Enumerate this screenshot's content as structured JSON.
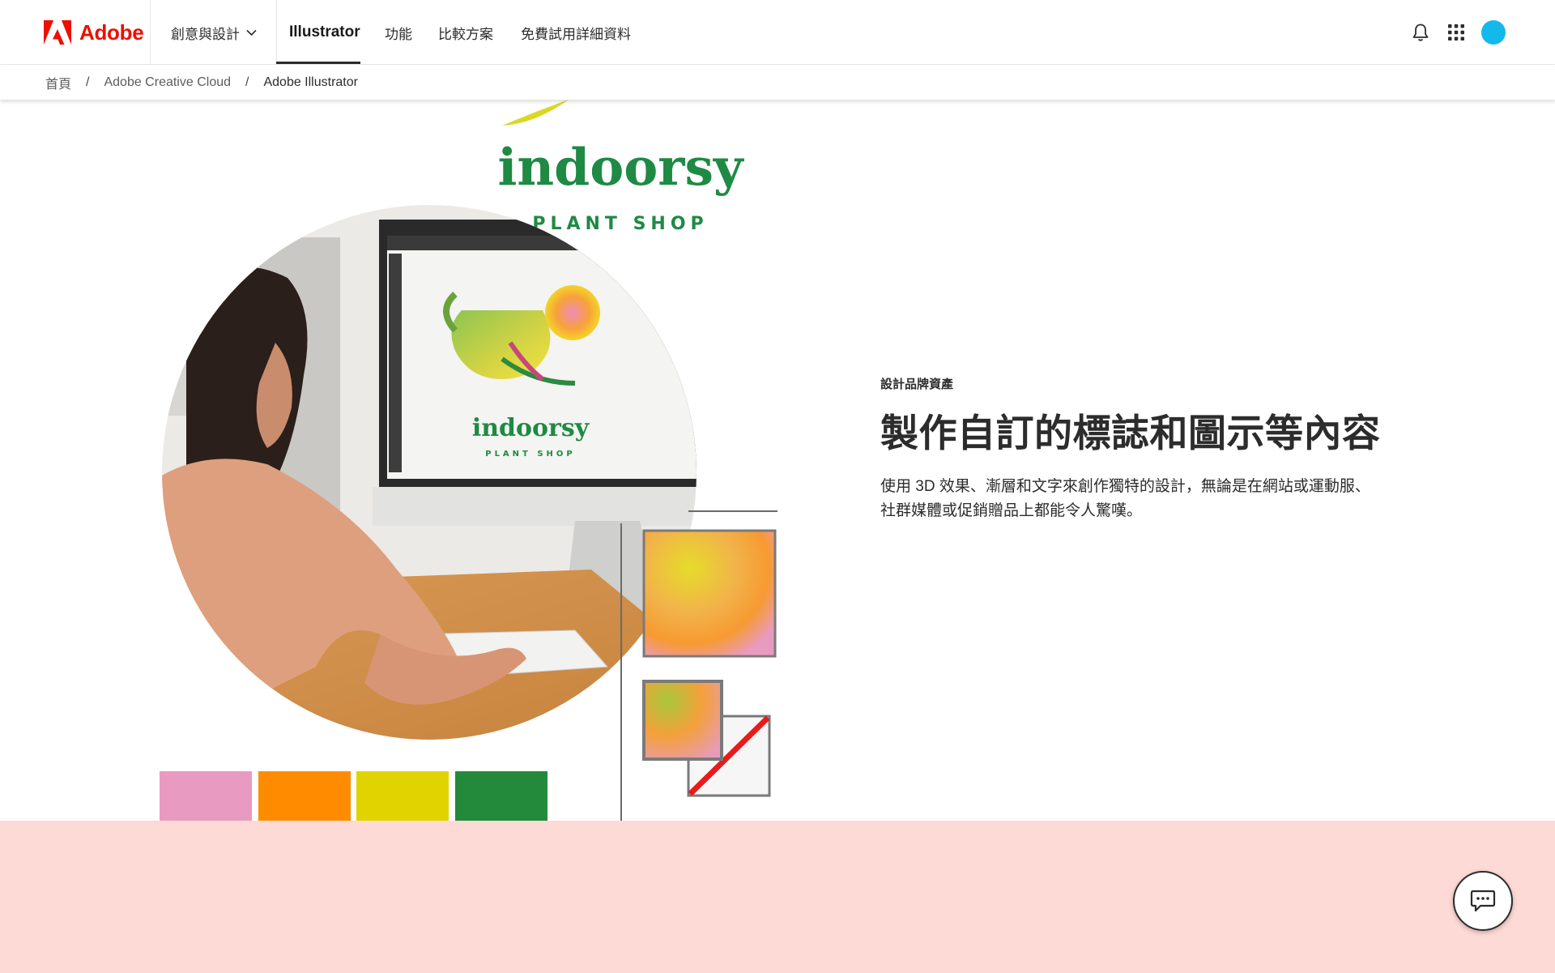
{
  "brand": {
    "name": "Adobe",
    "color": "#eb1000"
  },
  "nav": {
    "dropdown_label": "創意與設計",
    "active_item": "Illustrator",
    "items": [
      "功能",
      "比較方案",
      "免費試用詳細資料"
    ]
  },
  "header_icons": [
    "bell-icon",
    "apps-grid-icon",
    "avatar"
  ],
  "breadcrumb": {
    "items": [
      "首頁",
      "Adobe Creative Cloud"
    ],
    "current": "Adobe Illustrator",
    "separator": "/"
  },
  "hero": {
    "eyebrow": "設計品牌資產",
    "headline": "製作自訂的標誌和圖示等內容",
    "body": "使用 3D 效果、漸層和文字來創作獨特的設計，無論是在網站或運動服、社群媒體或促銷贈品上都能令人驚嘆。",
    "logo_word": "indoorsy",
    "logo_sub": "PLANT SHOP",
    "swatches": [
      "#e99ac0",
      "#ff8c00",
      "#e1d300",
      "#238a3c"
    ]
  },
  "colors": {
    "band": "#fddad5",
    "avatar": "#14b9ec",
    "logo_green": "#1e8a44"
  },
  "chat": {
    "icon": "chat-icon"
  }
}
